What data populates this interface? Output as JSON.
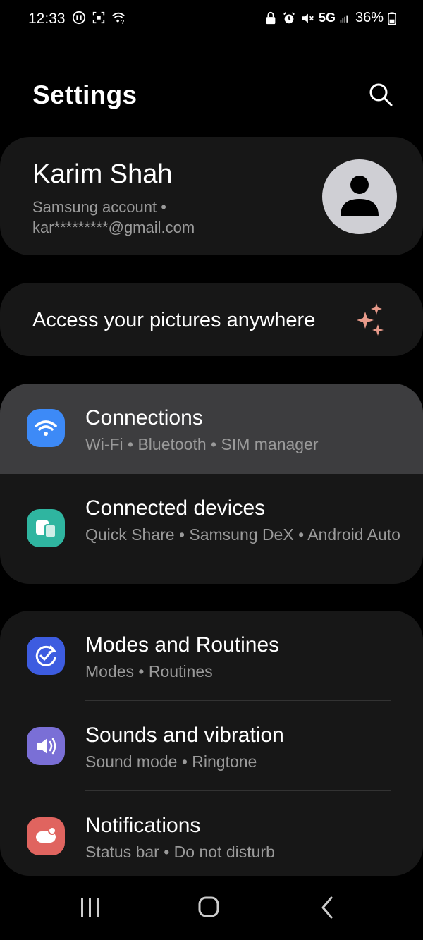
{
  "status_bar": {
    "time": "12:33",
    "network": "5G",
    "battery": "36%",
    "left_icons": [
      "media-icon",
      "screenshot-icon",
      "wifi-question-icon"
    ],
    "right_icons": [
      "lock-icon",
      "alarm-icon",
      "mute-icon",
      "signal-icon",
      "battery-icon"
    ]
  },
  "header": {
    "title": "Settings",
    "search_icon": "search-icon"
  },
  "profile": {
    "name": "Karim Shah",
    "account_label": "Samsung account  •",
    "email": "kar*********@gmail.com",
    "avatar_icon": "person-icon"
  },
  "promo": {
    "text": "Access your pictures anywhere",
    "icon": "sparkle-icon"
  },
  "groups": [
    {
      "items": [
        {
          "title": "Connections",
          "subtitle": "Wi-Fi  •  Bluetooth  •  SIM manager",
          "icon": "wifi-icon",
          "icon_color": "#3d8af7",
          "selected": true
        },
        {
          "title": "Connected devices",
          "subtitle": "Quick Share  •  Samsung DeX  •  Android Auto",
          "icon": "devices-icon",
          "icon_color": "#2fb5a0",
          "selected": false
        }
      ]
    },
    {
      "items": [
        {
          "title": "Modes and Routines",
          "subtitle": "Modes  •  Routines",
          "icon": "routine-check-icon",
          "icon_color": "#3d5ce0",
          "selected": false
        },
        {
          "title": "Sounds and vibration",
          "subtitle": "Sound mode  •  Ringtone",
          "icon": "speaker-icon",
          "icon_color": "#7a6fd6",
          "selected": false
        },
        {
          "title": "Notifications",
          "subtitle": "Status bar  •  Do not disturb",
          "icon": "notification-icon",
          "icon_color": "#e0645f",
          "selected": false
        }
      ]
    }
  ],
  "nav_bar": {
    "buttons": [
      "recents-icon",
      "home-icon",
      "back-icon"
    ]
  },
  "colors": {
    "background": "#000000",
    "card": "#171717",
    "selected_row": "#3d3d3f",
    "secondary_text": "#9a9a9a"
  }
}
